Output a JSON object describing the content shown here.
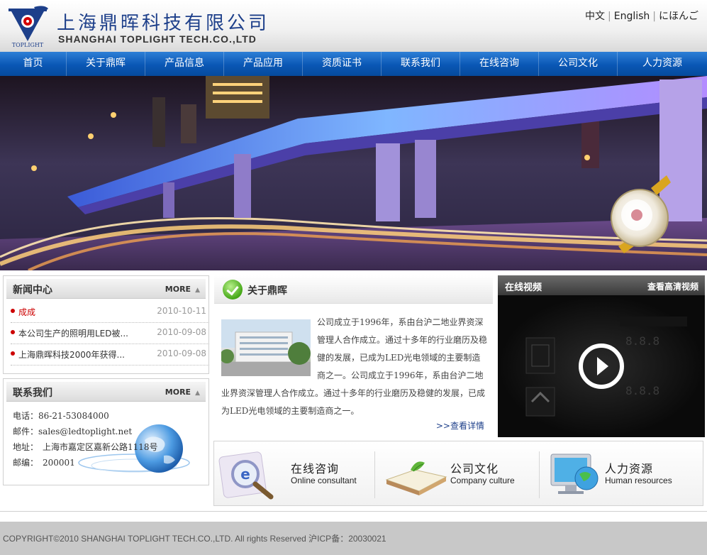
{
  "header": {
    "logo_cn": "上海鼎晖科技有限公司",
    "logo_en": "SHANGHAI TOPLIGHT TECH.CO.,LTD",
    "logo_mark_text": "TOPLIGHT",
    "languages": [
      "中文",
      "English",
      "にほんご"
    ]
  },
  "nav": {
    "items": [
      "首页",
      "关于鼎晖",
      "产品信息",
      "产品应用",
      "资质证书",
      "联系我们",
      "在线咨询",
      "公司文化",
      "人力资源"
    ]
  },
  "news": {
    "title": "新闻中心",
    "more": "MORE",
    "items": [
      {
        "title": "成成",
        "date": "2010-10-11"
      },
      {
        "title": "本公司生产的照明用LED被...",
        "date": "2010-09-08"
      },
      {
        "title": "上海鼎晖科技2000年获得...",
        "date": "2010-09-08"
      }
    ]
  },
  "contact": {
    "title": "联系我们",
    "more": "MORE",
    "phone_label": "电话：",
    "phone": "86-21-53084000",
    "email_label": "邮件：",
    "email": "sales@ledtoplight.net",
    "address_label": "地址：",
    "address": "上海市嘉定区嘉新公路1118号",
    "zip_label": "邮编：",
    "zip": "200001"
  },
  "about": {
    "title": "关于鼎晖",
    "text": "公司成立于1996年，系由台沪二地业界资深管理人合作成立。通过十多年的行业磨历及稳健的发展，已成为LED光电领域的主要制造商之一。公司成立于1996年，系由台沪二地业界资深管理人合作成立。通过十多年的行业磨历及稳健的发展，已成为LED光电领域的主要制造商之一。",
    "more_link": ">>查看详情"
  },
  "video": {
    "title": "在线视频",
    "hd_link": "查看高清视频"
  },
  "features": [
    {
      "cn": "在线咨询",
      "en": "Online consultant",
      "icon": "ie-magnifier-icon"
    },
    {
      "cn": "公司文化",
      "en": "Company culture",
      "icon": "open-book-icon"
    },
    {
      "cn": "人力资源",
      "en": "Human resources",
      "icon": "globe-monitor-icon"
    }
  ],
  "footer": {
    "copyright": "COPYRIGHT©2010 SHANGHAI TOPLIGHT TECH.CO.,LTD. All rights Reserved 沪ICP备：20030021"
  },
  "colors": {
    "nav_blue": "#0a57b5",
    "brand_navy": "#1d3f8a",
    "accent_red": "#cc0000"
  }
}
